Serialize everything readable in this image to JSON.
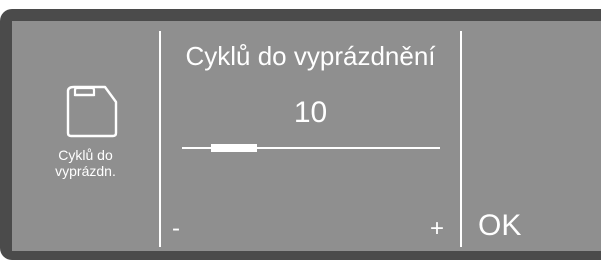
{
  "side_panel": {
    "icon": "canister-icon",
    "label_line1": "Cyklů do",
    "label_line2": "vyprázdn."
  },
  "setting": {
    "title": "Cyklů do vyprázdnění",
    "value": "10",
    "slider_level": 0.2
  },
  "controls": {
    "minus_label": "-",
    "plus_label": "+",
    "ok_label": "OK"
  },
  "colors": {
    "frame": "#4b4b4b",
    "screen": "#8f8f8f",
    "foreground": "#ffffff"
  }
}
